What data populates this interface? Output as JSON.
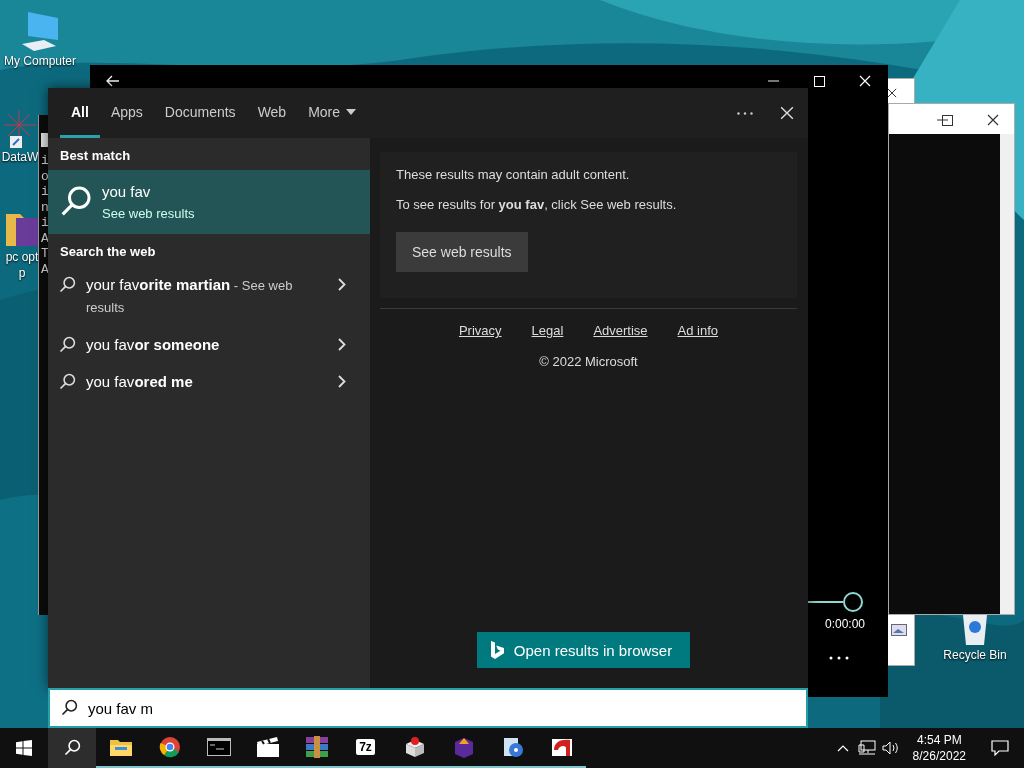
{
  "desktop_icons": [
    {
      "kind": "computer",
      "lines": [
        "My Computer"
      ]
    },
    {
      "kind": "shortcut",
      "lines": [
        "DataW"
      ]
    },
    {
      "kind": "folder",
      "lines": [
        "pc opt",
        "p"
      ]
    }
  ],
  "recycle_bin": {
    "label": "Recycle Bin"
  },
  "console_window": {
    "lines": [
      "i",
      "o",
      "i",
      "n",
      "i",
      "A",
      "T",
      "A"
    ]
  },
  "media_player": {
    "time": "0:00:00"
  },
  "search": {
    "tabs": [
      {
        "label": "All",
        "selected": true,
        "kind": "tab"
      },
      {
        "label": "Apps",
        "selected": false,
        "kind": "tab"
      },
      {
        "label": "Documents",
        "selected": false,
        "kind": "tab"
      },
      {
        "label": "Web",
        "selected": false,
        "kind": "tab"
      },
      {
        "label": "More",
        "selected": false,
        "kind": "menu"
      }
    ],
    "best_match_heading": "Best match",
    "best_match": {
      "title": "you fav",
      "subtitle": "See web results",
      "selected": true
    },
    "web_heading": "Search the web",
    "suggestions": [
      {
        "text": "your fav**orite martian**",
        "note": " - See web results"
      },
      {
        "text": "you fav**or someone**"
      },
      {
        "text": "you fav**ored me**"
      }
    ],
    "notice": {
      "lines": [
        "These results may contain adult content.",
        "To see results for **you fav**, click See web results."
      ],
      "button": "See web results"
    },
    "footer_links": [
      "Privacy",
      "Legal",
      "Advertise",
      "Ad info"
    ],
    "copyright": "© 2022 Microsoft",
    "open_browser": "Open results in browser",
    "query": "you fav m"
  },
  "taskbar": {
    "search_selected": true,
    "apps": [
      {
        "kind": "folder",
        "running": true
      },
      {
        "kind": "browser",
        "running": true
      },
      {
        "kind": "terminal",
        "running": true
      },
      {
        "kind": "clapper",
        "running": true
      },
      {
        "kind": "archive",
        "running": true
      },
      {
        "kind": "text",
        "label": "7z",
        "running": true
      },
      {
        "kind": "package",
        "running": true
      },
      {
        "kind": "box",
        "running": true
      },
      {
        "kind": "disc",
        "running": true
      },
      {
        "kind": "reader",
        "running": true
      }
    ],
    "time": "4:54 PM",
    "date": "8/26/2022"
  }
}
